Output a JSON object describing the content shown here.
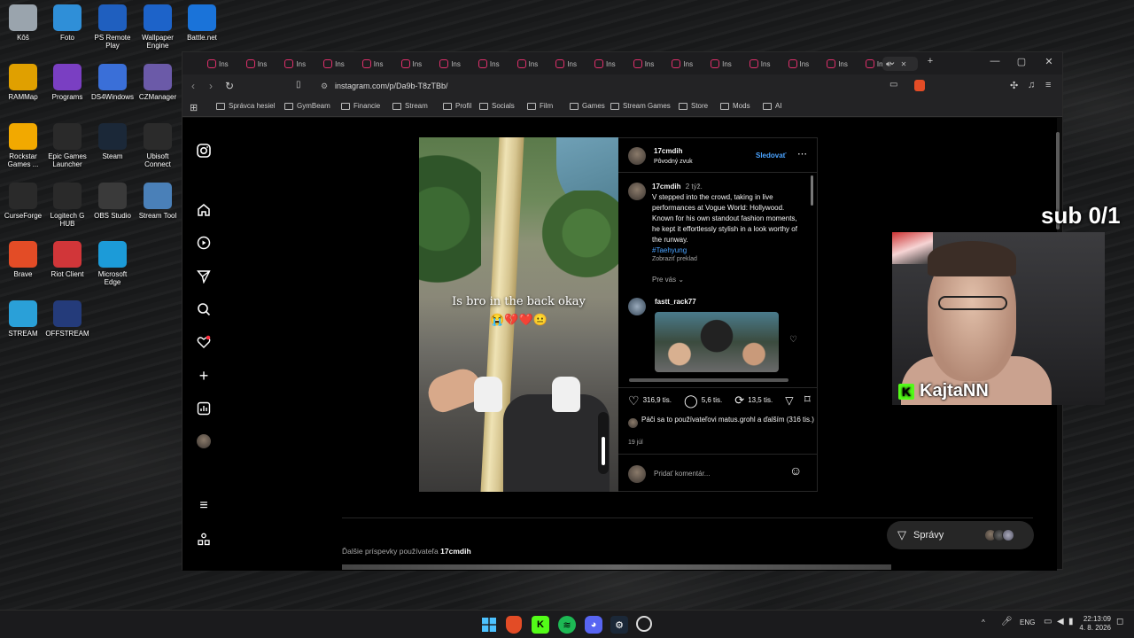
{
  "desktop": {
    "icons": [
      {
        "label": "Kôš",
        "icon": "recycle-bin-icon",
        "color": "#9aa4ad"
      },
      {
        "label": "Foto",
        "icon": "photos-icon",
        "color": "#2f8fd8"
      },
      {
        "label": "PS Remote Play",
        "icon": "ps-remote-play-icon",
        "color": "#1f5fbf"
      },
      {
        "label": "Wallpaper Engine",
        "icon": "wallpaper-engine-icon",
        "color": "#1d63c9"
      },
      {
        "label": "Battle.net",
        "icon": "battlenet-icon",
        "color": "#1a73d9"
      },
      {
        "label": "RAMMap",
        "icon": "rammap-icon",
        "color": "#e0a000"
      },
      {
        "label": "Programs",
        "icon": "programs-icon",
        "color": "#7a3fc2"
      },
      {
        "label": "DS4Windows",
        "icon": "ds4windows-icon",
        "color": "#3a6fd8"
      },
      {
        "label": "CZManager",
        "icon": "czmanager-icon",
        "color": "#6b5aa8"
      },
      {
        "label": "Rockstar Games ...",
        "icon": "rockstar-icon",
        "color": "#f2a900"
      },
      {
        "label": "Epic Games Launcher",
        "icon": "epic-games-icon",
        "color": "#2a2a2a"
      },
      {
        "label": "Steam",
        "icon": "steam-icon",
        "color": "#1b2838"
      },
      {
        "label": "Ubisoft Connect",
        "icon": "ubisoft-icon",
        "color": "#2b2b2b"
      },
      {
        "label": "CurseForge",
        "icon": "curseforge-icon",
        "color": "#2a2a2a"
      },
      {
        "label": "Logitech G HUB",
        "icon": "logitech-icon",
        "color": "#2a2a2a"
      },
      {
        "label": "OBS Studio",
        "icon": "obs-icon",
        "color": "#3a3a3a"
      },
      {
        "label": "Stream Tool",
        "icon": "stream-tool-icon",
        "color": "#4a80b8"
      },
      {
        "label": "Brave",
        "icon": "brave-icon",
        "color": "#e34c26"
      },
      {
        "label": "Riot Client",
        "icon": "riot-icon",
        "color": "#d13639"
      },
      {
        "label": "Microsoft Edge",
        "icon": "edge-icon",
        "color": "#1c9bd8"
      },
      {
        "label": "STREAM",
        "icon": "stream-icon",
        "color": "#2aa0d8"
      },
      {
        "label": "OFFSTREAM",
        "icon": "offstream-icon",
        "color": "#243b7a"
      }
    ]
  },
  "browser": {
    "tab_label": "Ins",
    "url": "instagram.com/p/Da9b-T8zTBb/",
    "bookmarks": [
      "Správca hesiel",
      "GymBeam",
      "Financie",
      "Stream",
      "Profil",
      "Socials",
      "Film",
      "Games",
      "Stream Games",
      "Store",
      "Mods",
      "AI"
    ]
  },
  "post": {
    "author": "17cmdih",
    "audio": "Pôvodný zvuk",
    "follow_label": "Sledovať",
    "caption_author": "17cmdih",
    "caption_age": "2 týž.",
    "caption_text": "V stepped into the crowd, taking in live performances at Vogue World: Hollywood. Known for his own standout fashion moments, he kept it effortlessly stylish in a look worthy of the runway.",
    "hashtag": "#Taehyung",
    "translate_label": "Zobraziť preklad",
    "for_you_label": "Pre vás",
    "suggested_user": "fastt_rack77",
    "video_overlay_text": "Is bro in the back okay",
    "video_overlay_emoji": "😭💔❤️😐",
    "likes": "316,9 tis.",
    "comments": "5,6 tis.",
    "reposts": "13,5 tis.",
    "liked_by_text": "Páči sa to používateľovi matus.grohl a ďalším (316 tis.)",
    "date": "19 júl",
    "comment_placeholder": "Pridať komentár..."
  },
  "more_posts": {
    "prefix": "Ďalšie príspevky používateľa",
    "user": "17cmdih"
  },
  "messages_label": "Správy",
  "stream_overlay": {
    "sub_goal": "sub 0/1",
    "streamer_name": "KajtaNN",
    "platform_icon": "K"
  },
  "taskbar": {
    "language": "ENG",
    "time": "22:13:09",
    "date": "4. 8. 2026"
  },
  "colors": {
    "instagram_accent": "#e1306c",
    "follow_blue": "#4aa3ff",
    "kick_green": "#53fc18"
  }
}
